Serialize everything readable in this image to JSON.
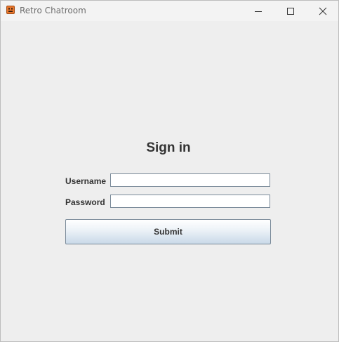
{
  "window": {
    "title": "Retro Chatroom",
    "controls": [
      "minimize",
      "maximize",
      "close"
    ]
  },
  "form": {
    "heading": "Sign in",
    "username_label": "Username",
    "username_value": "",
    "password_label": "Password",
    "password_value": "",
    "submit_label": "Submit"
  },
  "icons": {
    "app": "retro-chatroom-app-icon",
    "minimize": "minimize-icon",
    "maximize": "maximize-icon",
    "close": "close-icon"
  },
  "colors": {
    "app_icon": "#e8772e",
    "button_gradient_top": "#ffffff",
    "button_gradient_bottom": "#c9d9e8",
    "field_border": "#7a8a99"
  }
}
